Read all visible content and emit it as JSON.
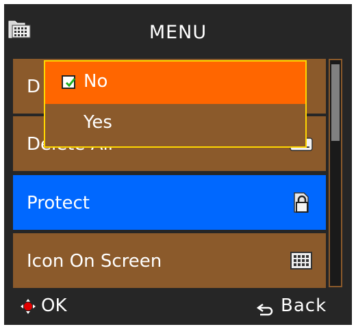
{
  "header": {
    "title": "MENU",
    "icon": "folder-icon"
  },
  "menu": {
    "items": [
      {
        "label": "D",
        "icon": "delete-icon",
        "selected": false
      },
      {
        "label": "Delete All",
        "icon": "delete-all-icon",
        "icon_text": "ALL",
        "selected": false
      },
      {
        "label": "Protect",
        "icon": "lock-icon",
        "selected": true
      },
      {
        "label": "Icon On Screen",
        "icon": "screen-icon",
        "selected": false
      }
    ]
  },
  "popup": {
    "options": [
      {
        "label": "No",
        "selected": true,
        "icon": "checkbox-icon"
      },
      {
        "label": "Yes",
        "selected": false
      }
    ]
  },
  "footer": {
    "ok_label": "OK",
    "back_label": "Back",
    "ok_icon": "dpad-icon",
    "back_icon": "back-arrow-icon"
  },
  "colors": {
    "background": "#262626",
    "item": "#8b5a2b",
    "selected_item": "#0068ff",
    "popup_selected": "#ff6600",
    "popup_border": "#ffd700"
  },
  "scrollbar": {
    "position": 0.0,
    "thumb_fraction": 0.33
  }
}
